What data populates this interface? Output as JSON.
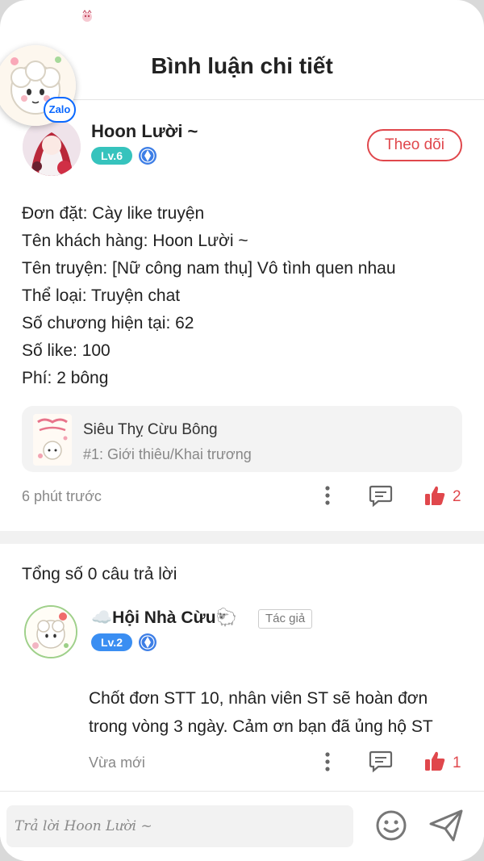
{
  "header": {
    "title": "Bình luận chi tiết"
  },
  "floating_widget": {
    "badge_label": "Zalo"
  },
  "comment": {
    "author_name": "Hoon Lười ~",
    "level": "Lv.6",
    "follow_label": "Theo dõi",
    "lines": [
      "Đơn đặt: Cày like truyện",
      "Tên khách hàng: Hoon Lười ~",
      "Tên truyện: [Nữ công nam thụ] Vô tình quen nhau",
      "Thể loại: Truyện chat",
      "Số chương hiện tại: 62",
      "Số like: 100",
      "Phí: 2 bông"
    ],
    "story_card": {
      "name": "Siêu Thỵ Cừu Bông",
      "chapter": "#1: Giới thiêu/Khai trương"
    },
    "time": "6 phút trước",
    "like_count": "2"
  },
  "replies": {
    "total_text": "Tổng số 0 câu trả lời",
    "items": [
      {
        "author_name": "☁️Hội Nhà Cừu🐑",
        "author_tag": "Tác giả",
        "level": "Lv.2",
        "lines": [
          "Chốt đơn STT 10, nhân viên ST sẽ hoàn đơn",
          "trong vòng 3 ngày. Cảm ơn bạn đã ủng hộ ST"
        ],
        "time": "Vừa mới",
        "like_count": "1"
      }
    ]
  },
  "composer": {
    "placeholder": "Trả lời Hoon Lười ~"
  },
  "colors": {
    "accent_red": "#e0474c",
    "level6_teal": "#36c3bd",
    "level2_blue": "#3a8ef2",
    "zalo_blue": "#0a68ff"
  },
  "icons": [
    "status-app-icon",
    "badge-diamond-icon",
    "more-vertical-icon",
    "comment-icon",
    "thumbs-up-icon",
    "emoji-icon",
    "send-icon"
  ]
}
